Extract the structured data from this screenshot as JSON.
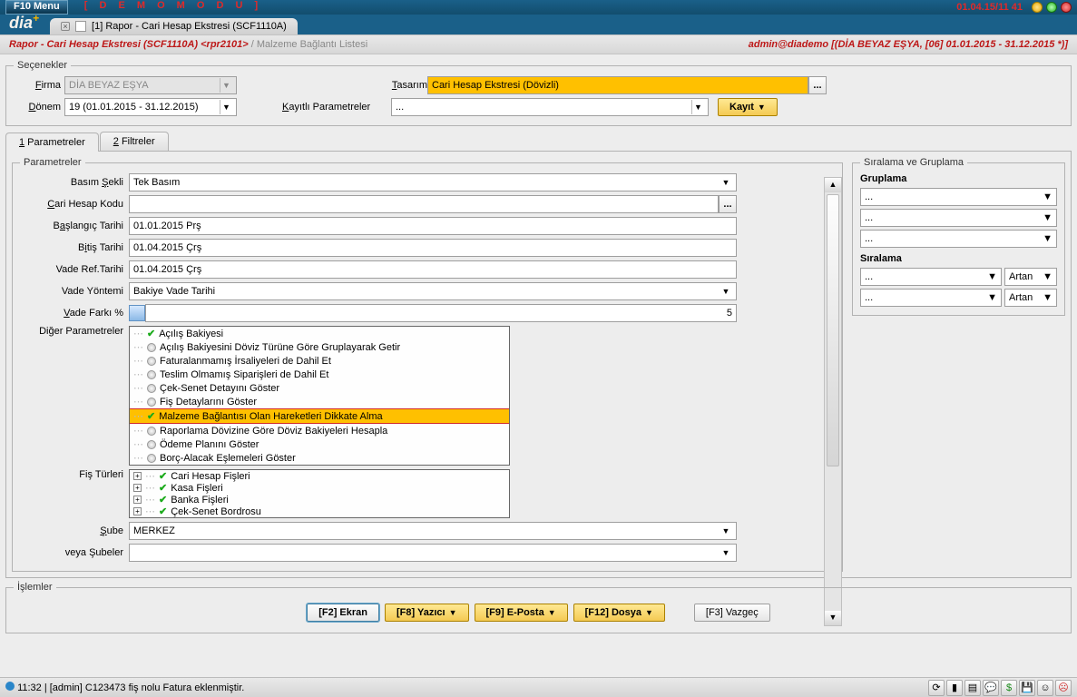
{
  "topbar": {
    "f10": "F10 Menu",
    "demo": "[ D E M O   M O D U ]",
    "datetime": "01.04.15/11 41"
  },
  "tab": {
    "title": "[1] Rapor - Cari Hesap Ekstresi (SCF1110A)"
  },
  "breadcrumb": {
    "main": "Rapor - Cari Hesap Ekstresi (SCF1110A) <rpr2101>",
    "sub": " / Malzeme Bağlantı Listesi",
    "right": "admin@diademo [(DİA BEYAZ EŞYA, [06] 01.01.2015 - 31.12.2015 *)]"
  },
  "secenekler": {
    "legend": "Seçenekler",
    "firma_lbl": "Firma",
    "firma_val": "DİA BEYAZ EŞYA",
    "tasarim_lbl": "Tasarım",
    "tasarim_val": "Cari Hesap Ekstresi (Dövizli)",
    "donem_lbl": "Dönem",
    "donem_val": "19 (01.01.2015 - 31.12.2015)",
    "kayitli_lbl": "Kayıtlı Parametreler",
    "kayitli_val": "...",
    "kayit_btn": "Kayıt"
  },
  "subtabs": {
    "t1": "1 Parametreler",
    "t2": "2 Filtreler"
  },
  "params": {
    "legend": "Parametreler",
    "basim_lbl": "Basım Şekli",
    "basim_val": "Tek Basım",
    "cari_lbl": "Cari Hesap Kodu",
    "cari_val": "",
    "baslangic_lbl": "Başlangıç Tarihi",
    "baslangic_val": "01.01.2015 Prş",
    "bitis_lbl": "Bitiş Tarihi",
    "bitis_val": "01.04.2015 Çrş",
    "vaderef_lbl": "Vade Ref.Tarihi",
    "vaderef_val": "01.04.2015 Çrş",
    "vadeyon_lbl": "Vade Yöntemi",
    "vadeyon_val": "Bakiye Vade Tarihi",
    "vadefark_lbl": "Vade Farkı %",
    "vadefark_val": "5",
    "diger_lbl": "Diğer Parametreler",
    "diger": [
      {
        "label": "Açılış Bakiyesi",
        "checked": true
      },
      {
        "label": "Açılış Bakiyesini Döviz Türüne Göre Gruplayarak Getir",
        "checked": false
      },
      {
        "label": "Faturalanmamış İrsaliyeleri de Dahil Et",
        "checked": false
      },
      {
        "label": "Teslim Olmamış Siparişleri de Dahil Et",
        "checked": false
      },
      {
        "label": "Çek-Senet Detayını Göster",
        "checked": false
      },
      {
        "label": "Fiş Detaylarını Göster",
        "checked": false
      },
      {
        "label": "Malzeme Bağlantısı Olan Hareketleri Dikkate Alma",
        "checked": true,
        "selected": true
      },
      {
        "label": "Raporlama Dövizine Göre Döviz Bakiyeleri Hesapla",
        "checked": false
      },
      {
        "label": "Ödeme Planını Göster",
        "checked": false
      },
      {
        "label": "Borç-Alacak Eşlemeleri Göster",
        "checked": false
      }
    ],
    "fis_lbl": "Fiş Türleri",
    "fis": [
      "Cari Hesap Fişleri",
      "Kasa Fişleri",
      "Banka Fişleri",
      "Çek-Senet Bordrosu"
    ],
    "sube_lbl": "Şube",
    "sube_val": "MERKEZ",
    "veya_lbl": "veya Şubeler",
    "veya_val": ""
  },
  "sorting": {
    "legend": "Sıralama ve Gruplama",
    "grup_hdr": "Gruplama",
    "siralama_hdr": "Sıralama",
    "dots": "...",
    "artan": "Artan"
  },
  "islemler": {
    "legend": "İşlemler",
    "ekran": "[F2] Ekran",
    "yazici": "[F8] Yazıcı",
    "eposta": "[F9] E-Posta",
    "dosya": "[F12] Dosya",
    "vazgec": "[F3] Vazgeç"
  },
  "status": {
    "text": "11:32 | [admin] C123473 fiş nolu Fatura eklenmiştir."
  }
}
